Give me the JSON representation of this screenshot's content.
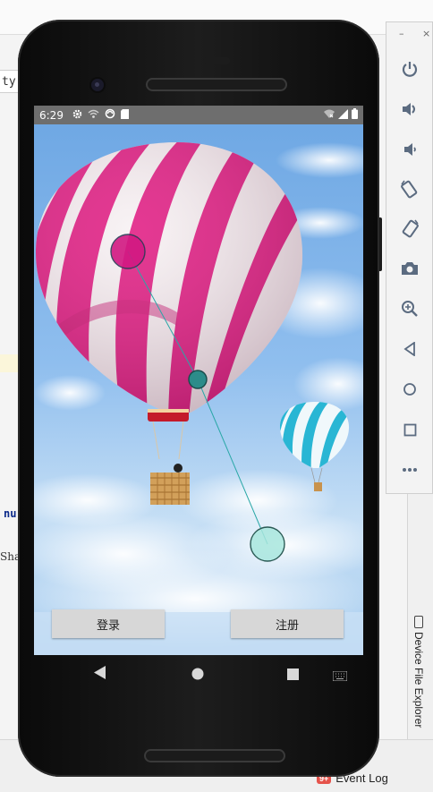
{
  "ide": {
    "tab_fragment": "ty.j",
    "code_fragment_1": "nu",
    "code_fragment_2": "Sha",
    "event_log_label": "Event Log",
    "event_log_badge": "9+",
    "device_explorer_label": "Device File Explorer"
  },
  "phone": {
    "status_bar": {
      "time": "6:29",
      "left_icons": [
        "gear-icon",
        "no-signal-icon",
        "sync-icon",
        "sdcard-icon"
      ],
      "right_icons": [
        "wifi-icon",
        "signal-icon",
        "battery-icon"
      ]
    },
    "app": {
      "background_scene": "hot-air-balloons",
      "login_button": "登录",
      "register_button": "注册"
    },
    "nav_bar": [
      "back-icon",
      "home-icon",
      "recents-icon",
      "keyboard-icon"
    ]
  },
  "emulator_panel": {
    "window_controls": [
      "minimize-icon",
      "close-icon"
    ],
    "controls": [
      "power-icon",
      "volume-up-icon",
      "volume-down-icon",
      "rotate-left-icon",
      "rotate-right-icon",
      "camera-icon",
      "zoom-icon",
      "back-icon",
      "home-icon",
      "overview-icon",
      "more-icon"
    ]
  },
  "colors": {
    "sky": "#7ab0e6",
    "balloon_pink": "#e0157f",
    "balloon_cyan": "#29b6d4",
    "status_bar": "#6e6e6e",
    "button_bg": "#d7d7d7"
  }
}
